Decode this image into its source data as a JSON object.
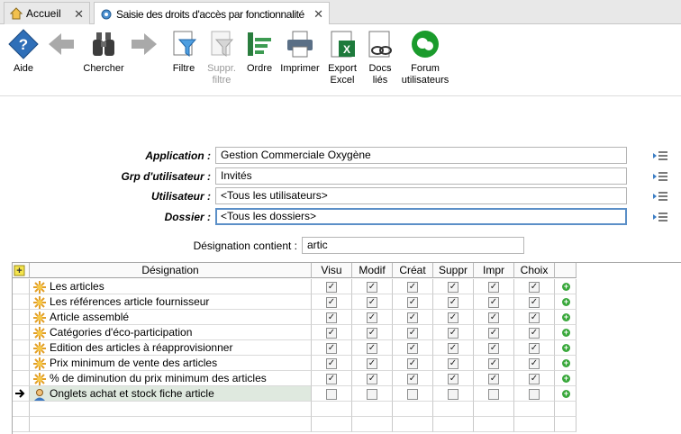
{
  "tabs": [
    {
      "label": "Accueil",
      "icon": "home-icon",
      "active": false
    },
    {
      "label": "Saisie des droits d'accès par fonctionnalité",
      "icon": "gear-icon",
      "active": true
    }
  ],
  "toolbar": {
    "aide": "Aide",
    "chercher": "Chercher",
    "filtre": "Filtre",
    "suppr_filtre": "Suppr. filtre",
    "ordre": "Ordre",
    "imprimer": "Imprimer",
    "export_excel": "Export Excel",
    "docs_lies": "Docs liés",
    "forum": "Forum utilisateurs"
  },
  "form": {
    "application_label": "Application :",
    "application_value": "Gestion Commerciale Oxygène",
    "grp_label": "Grp d'utilisateur :",
    "grp_value": "Invités",
    "utilisateur_label": "Utilisateur :",
    "utilisateur_value": "<Tous les utilisateurs>",
    "dossier_label": "Dossier :",
    "dossier_value": "<Tous les dossiers>",
    "designation_label": "Désignation contient :",
    "designation_value": "artic"
  },
  "grid": {
    "columns": [
      "Désignation",
      "Visu",
      "Modif",
      "Créat",
      "Suppr",
      "Impr",
      "Choix"
    ],
    "rows": [
      {
        "label": "Les articles",
        "checks": [
          true,
          true,
          true,
          true,
          true,
          true
        ],
        "icon": "sun-icon"
      },
      {
        "label": "Les références article fournisseur",
        "checks": [
          true,
          true,
          true,
          true,
          true,
          true
        ],
        "icon": "sun-icon"
      },
      {
        "label": "Article assemblé",
        "checks": [
          true,
          true,
          true,
          true,
          true,
          true
        ],
        "icon": "sun-icon"
      },
      {
        "label": "Catégories d'éco-participation",
        "checks": [
          true,
          true,
          true,
          true,
          true,
          true
        ],
        "icon": "sun-icon"
      },
      {
        "label": "Edition des articles à réapprovisionner",
        "checks": [
          true,
          true,
          true,
          true,
          true,
          true
        ],
        "icon": "sun-icon"
      },
      {
        "label": "Prix minimum de vente des articles",
        "checks": [
          true,
          true,
          true,
          true,
          true,
          true
        ],
        "icon": "sun-icon"
      },
      {
        "label": "% de diminution du prix minimum des articles",
        "checks": [
          true,
          true,
          true,
          true,
          true,
          true
        ],
        "icon": "sun-icon"
      },
      {
        "label": "Onglets achat et stock fiche article",
        "checks": [
          false,
          false,
          false,
          false,
          false,
          false
        ],
        "icon": "user-icon",
        "selected": true
      }
    ]
  },
  "colors": {
    "accent": "#1f6fb5",
    "green": "#1a9b2c",
    "selected_row": "#dfe9df"
  }
}
